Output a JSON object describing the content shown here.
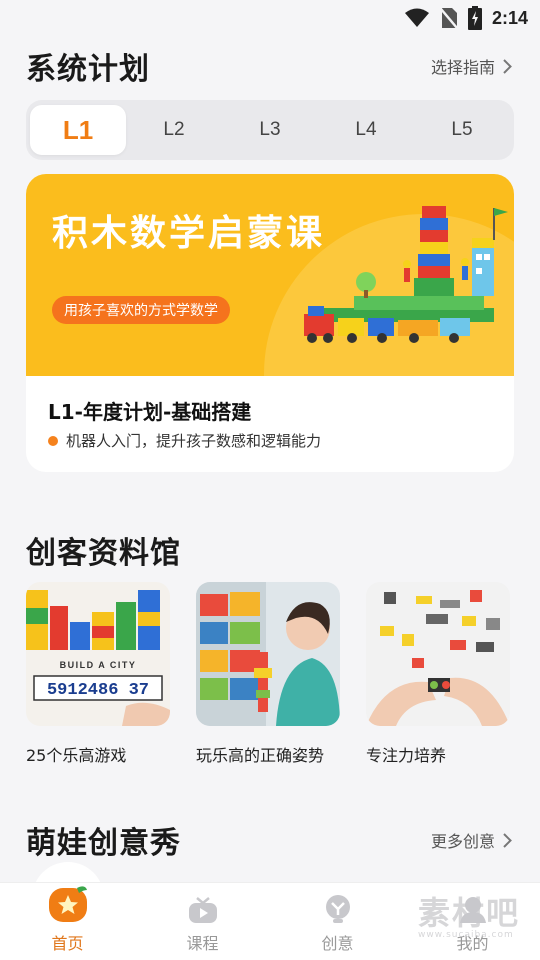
{
  "status_bar": {
    "time": "2:14"
  },
  "plan_section": {
    "title": "系统计划",
    "link": "选择指南"
  },
  "level_tabs": [
    "L1",
    "L2",
    "L3",
    "L4",
    "L5"
  ],
  "active_level": "L1",
  "course": {
    "banner_title": "积木数学启蒙课",
    "banner_tag": "用孩子喜欢的方式学数学",
    "name": "L1-年度计划-基础搭建",
    "description": "机器人入门，提升孩子数感和逻辑能力"
  },
  "maker_section": {
    "title": "创客资料馆",
    "items": [
      {
        "caption": "25个乐高游戏",
        "image_text": "BUILD A CITY",
        "image_numbers": "5912486 37"
      },
      {
        "caption": "玩乐高的正确姿势"
      },
      {
        "caption": "专注力培养"
      }
    ]
  },
  "show_section": {
    "title": "萌娃创意秀",
    "link": "更多创意"
  },
  "bottom_nav": [
    {
      "label": "首页",
      "icon": "star-home-icon",
      "active": true
    },
    {
      "label": "课程",
      "icon": "tv-icon",
      "active": false
    },
    {
      "label": "创意",
      "icon": "idea-icon",
      "active": false
    },
    {
      "label": "我的",
      "icon": "user-icon",
      "active": false
    }
  ],
  "watermark": {
    "text": "素材吧",
    "sub": "www.sucaiba.com"
  },
  "colors": {
    "accent": "#f07d14",
    "banner": "#fbbd1d",
    "pill": "#f5731d",
    "background": "#f5f5f7"
  }
}
